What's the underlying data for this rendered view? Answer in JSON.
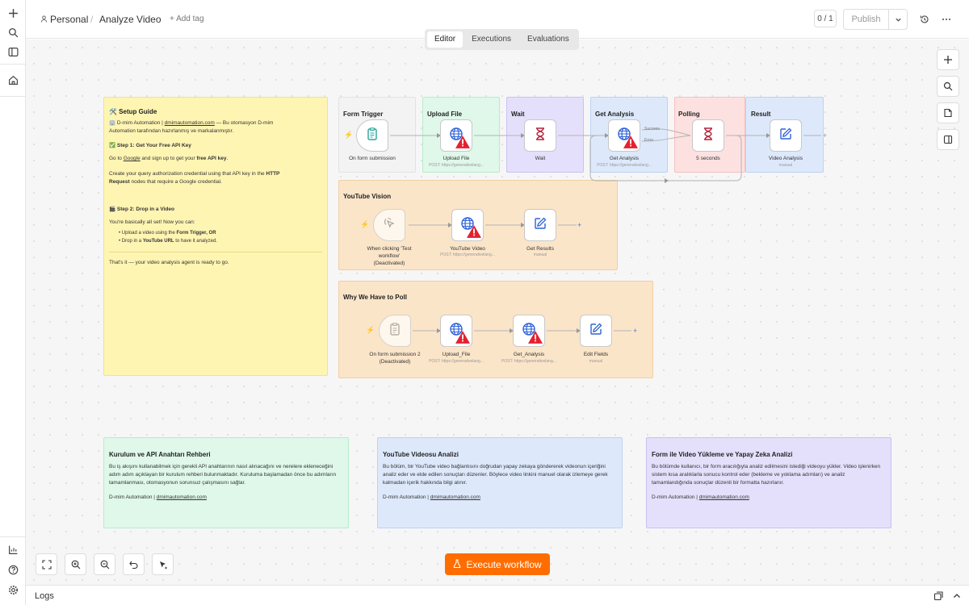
{
  "header": {
    "project": "Personal",
    "workflow_name": "Analyze Video",
    "add_tag": "+ Add tag",
    "counter": "0 / 1",
    "publish": "Publish"
  },
  "view_tabs": [
    "Editor",
    "Executions",
    "Evaluations"
  ],
  "setup_guide": {
    "title": "🛠️ Setup Guide",
    "line1_a": "🏢 D-mim Automation |",
    "line1_link": "dmimautomation.com",
    "line1_b": " — Bu otomasyon D-mim",
    "line2": "Automation tarafından hazırlanmış ve markalanmıştır.",
    "step1": "✅ Step 1: Get Your Free API Key",
    "step1_a": "Go to",
    "step1_link": "Google",
    "step1_b": "and sign up to get your",
    "step1_bold": "free API key",
    "step1_c": "Create your query authorization credential using that API key in the",
    "step1_bold2": "HTTP",
    "step1_d": "Request",
    "step1_e": "nodes that require a Google credential.",
    "step2": "🎬 Step 2: Drop in a Video",
    "step2_a": "You're basically all set! Now you can:",
    "bullet1_a": "Upload a video using the",
    "bullet1_bold": "Form Trigger",
    "bullet1_b": ", OR",
    "bullet2_a": "Drop in a",
    "bullet2_bold": "YouTube URL",
    "bullet2_b": "to have it analyzed.",
    "closing": "That's it — your video analysis agent is ready to go."
  },
  "groups": {
    "form_trigger": "Form Trigger",
    "upload_file": "Upload File",
    "wait": "Wait",
    "get_analysis": "Get Analysis",
    "polling": "Polling",
    "result": "Result",
    "youtube_vision": "YouTube Vision",
    "why_poll": "Why We Have to Poll"
  },
  "nodes": {
    "on_form_submission": "On form submission",
    "upload_file": "Upload File",
    "upload_file_sub": "POST: https://generativelang...",
    "wait": "Wait",
    "get_analysis": "Get Analysis",
    "get_analysis_sub": "POST: https://generativelang...",
    "success": "Success",
    "error": "Error",
    "five_seconds": "5 seconds",
    "video_analysis": "Video Analysis",
    "video_analysis_sub": "manual",
    "when_clicking_1": "When clicking 'Test",
    "when_clicking_2": "workflow'",
    "when_clicking_3": "(Deactivated)",
    "youtube_video": "YouTube Video",
    "youtube_video_sub": "POST: https://generativelang...",
    "get_results": "Get Results",
    "get_results_sub": "manual",
    "on_form_submission_2_a": "On form submission 2",
    "on_form_submission_2_b": "(Deactivated)",
    "upload_file_2": "Upload_File",
    "upload_file_2_sub": "POST: https://generativelang...",
    "get_analysis_2": "Get_Analysis",
    "get_analysis_2_sub": "POST: https://generativelang...",
    "edit_fields": "Edit Fields",
    "edit_fields_sub": "manual"
  },
  "notes": {
    "green_title": "Kurulum ve API Anahtarı Rehberi",
    "green_body": "Bu iş akışını kullanabilmek için gerekli API anahtarının nasıl alınacağını ve nerelere ekleneceğini adım adım açıklayan bir kurulum rehberi bulunmaktadır. Kuruluma başlamadan önce bu adımların tamamlanması, otomasyonun sorunsuz çalışmasını sağlar.",
    "blue_title": "YouTube Videosu Analizi",
    "blue_body": "Bu bölüm, bir YouTube video bağlantısını doğrudan yapay zekaya göndererek videonun içeriğini analiz eder ve elde edilen sonuçları düzenler. Böylece video linkini manuel olarak izlemeye gerek kalmadan içerik hakkında bilgi alınır.",
    "purple_title": "Form ile Video Yükleme ve Yapay Zeka Analizi",
    "purple_body": "Bu bölümde kullanıcı, bir form aracılığıyla analiz edilmesini istediği videoyu yükler. Video işlenirken sistem kısa aralıklarla sonucu kontrol eder (bekleme ve yoklama adımları) ve analiz tamamlandığında sonuçlar düzenli bir formatta hazırlanır.",
    "brand": "D-mim Automation |",
    "brand_link": "dmimautomation.com"
  },
  "execute_button": "Execute workflow",
  "logs_label": "Logs",
  "colors": {
    "accent": "#ff6d00",
    "sticky_yellow": "#fff5b3",
    "sticky_green": "#dff8e9",
    "sticky_blue": "#dde9fb",
    "sticky_purple": "#e4e0fb",
    "sticky_orange": "#fbe5c9",
    "sticky_red": "#fde1e1",
    "warning": "#e5202f"
  }
}
